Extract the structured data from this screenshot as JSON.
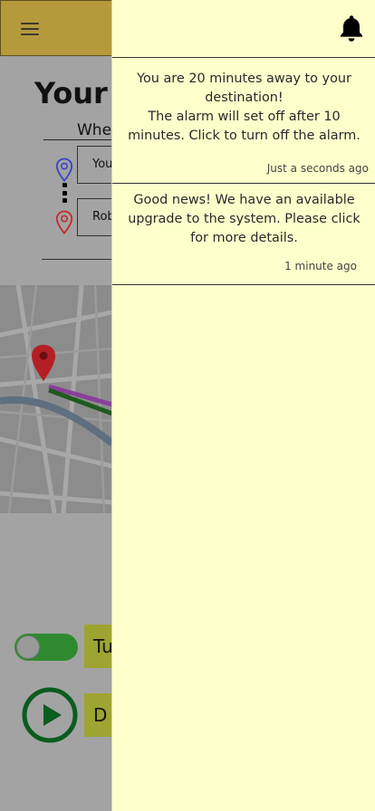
{
  "screen": {
    "title": "Your C",
    "where_label": "Wher",
    "from_field": {
      "value": "You"
    },
    "to_field": {
      "value": "Rob"
    },
    "toggle": {
      "state": "on",
      "label": "Tu"
    },
    "drive_label": "D"
  },
  "drawer": {
    "notifications": [
      {
        "text": "You are 20 minutes away to your destination!\nThe alarm will set off after 10 minutes. Click to turn off the alarm.",
        "time": "Just a seconds ago"
      },
      {
        "text": "Good news! We have an available upgrade to the system. Please click for more details.",
        "time": "1 minute ago"
      }
    ]
  },
  "icons": {
    "menu": "hamburger-icon",
    "bell": "bell-icon",
    "from_pin": "location-pin-icon",
    "to_pin": "location-pin-icon",
    "play": "play-icon"
  },
  "colors": {
    "header": "#b59a3c",
    "drawer_bg": "#ffffcc",
    "overlay": "#a3a3a3",
    "toggle_on": "#2f8a2f",
    "action_box": "#9ea431",
    "play": "#0a5c1f",
    "pin_from": "#3a42c8",
    "pin_to": "#c62828"
  }
}
